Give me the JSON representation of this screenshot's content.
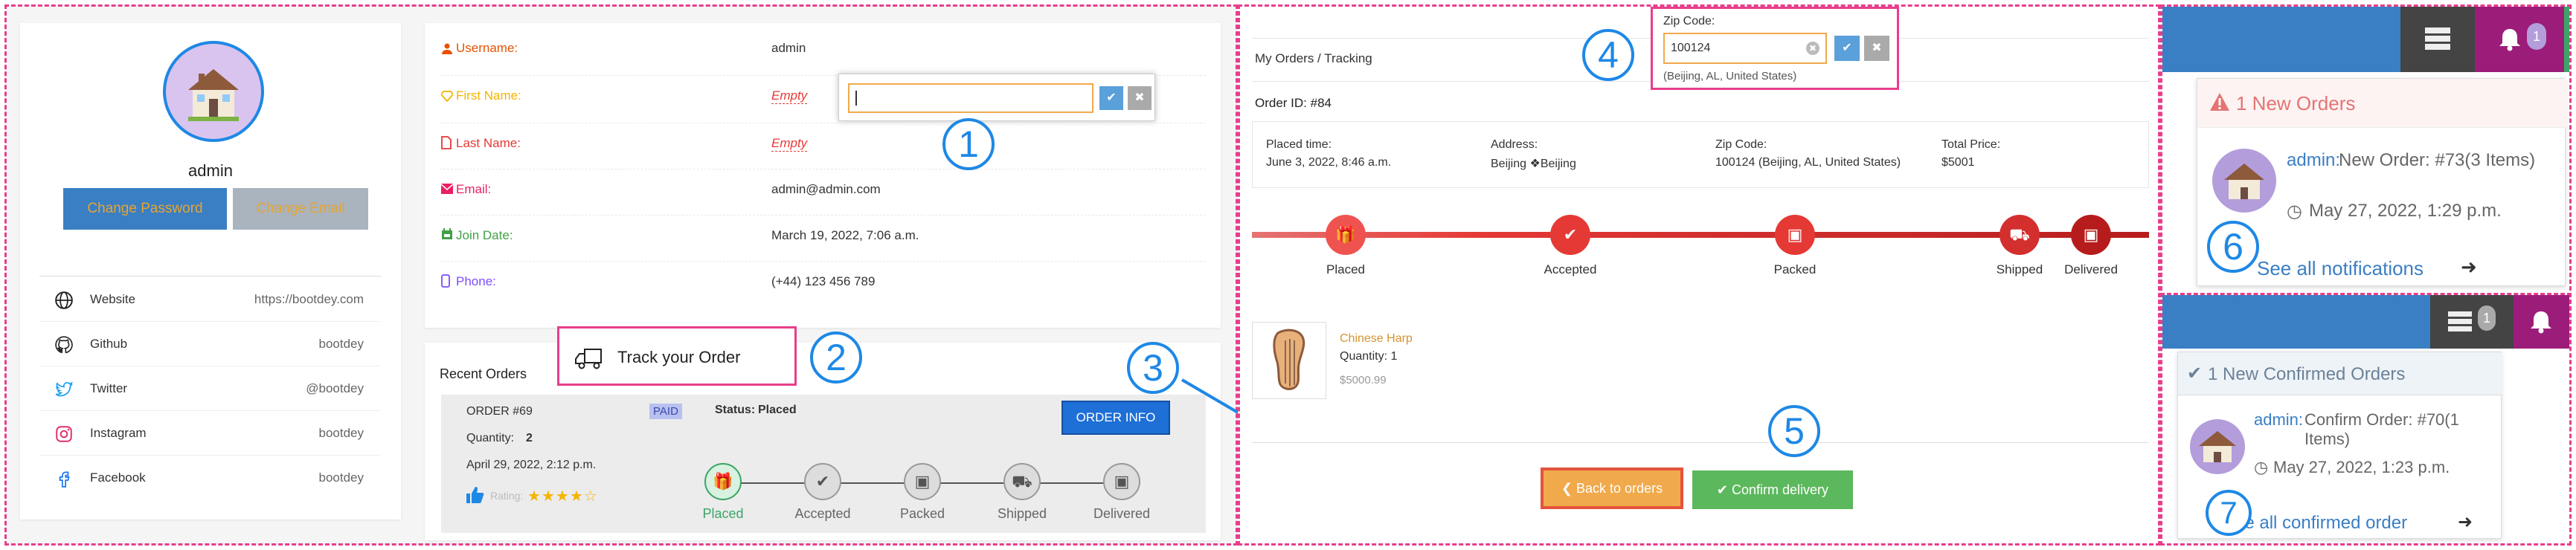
{
  "profile": {
    "name": "admin",
    "change_password": "Change Password",
    "change_email": "Change Email",
    "social": [
      {
        "label": "Website",
        "value": "https://bootdey.com",
        "icon": "globe-icon"
      },
      {
        "label": "Github",
        "value": "bootdey",
        "icon": "github-icon"
      },
      {
        "label": "Twitter",
        "value": "@bootdey",
        "icon": "twitter-icon"
      },
      {
        "label": "Instagram",
        "value": "bootdey",
        "icon": "instagram-icon"
      },
      {
        "label": "Facebook",
        "value": "bootdey",
        "icon": "facebook-icon"
      }
    ]
  },
  "details": {
    "username_label": "Username:",
    "username_value": "admin",
    "firstname_label": "First Name:",
    "firstname_value": "Empty",
    "lastname_label": "Last Name:",
    "lastname_value": "Empty",
    "email_label": "Email:",
    "email_value": "admin@admin.com",
    "joindate_label": "Join Date:",
    "joindate_value": "March 19, 2022, 7:06 a.m.",
    "phone_label": "Phone:",
    "phone_value": "(+44) 123 456 789",
    "colors": {
      "username": "#e65100",
      "firstname": "#f4b400",
      "lastname": "#e53935",
      "email": "#e91e63",
      "joindate": "#43a047",
      "phone": "#7c4dff"
    }
  },
  "annotations": {
    "n1": "1",
    "n2": "2",
    "n3": "3",
    "n4": "4",
    "n5": "5",
    "n6": "6",
    "n7": "7"
  },
  "recent_orders": {
    "title": "Recent Orders",
    "track_label": "Track your Order",
    "order_no": "ORDER #69",
    "paid_badge": "PAID",
    "status_prefix": "Status:",
    "status_value": "Placed",
    "quantity_label": "Quantity:",
    "quantity_value": "2",
    "date": "April 29, 2022, 2:12 p.m.",
    "rating_label": "Rating:",
    "rating_stars": 4,
    "order_info": "ORDER INFO",
    "steps": [
      "Placed",
      "Accepted",
      "Packed",
      "Shipped",
      "Delivered"
    ]
  },
  "tracking": {
    "header": "My Orders / Tracking",
    "order_id": "Order ID: #84",
    "placed_time_label": "Placed time:",
    "placed_time_value": "June 3, 2022, 8:46 a.m.",
    "address_label": "Address:",
    "address_value": "Beijing ❖Beijing",
    "zip_label": "Zip Code:",
    "zip_value": "100124 (Beijing, AL, United States)",
    "total_label": "Total Price:",
    "total_value": "$5001",
    "steps": [
      "Placed",
      "Accepted",
      "Packed",
      "Shipped",
      "Delivered"
    ],
    "product_name": "Chinese Harp",
    "product_qty": "Quantity: 1",
    "product_price": "$5000.99",
    "back_button": "Back to orders",
    "confirm_button": "Confirm delivery",
    "zip_popup_label": "Zip Code:",
    "zip_popup_value": "100124",
    "zip_popup_hint": "(Beijing, AL, United States)"
  },
  "notifications": {
    "header_count": "1",
    "title": "1 New Orders",
    "user": "admin:",
    "message": "New Order: #73(3 Items)",
    "time": "May 27, 2022, 1:29 p.m.",
    "see_all": "See all notifications"
  },
  "confirmed": {
    "header_count": "1",
    "title": "1 New Confirmed Orders",
    "user": "admin:",
    "message": "Confirm Order: #70(1 Items)",
    "time": "May 27, 2022, 1:23 p.m.",
    "see_all": "See all confirmed order"
  }
}
